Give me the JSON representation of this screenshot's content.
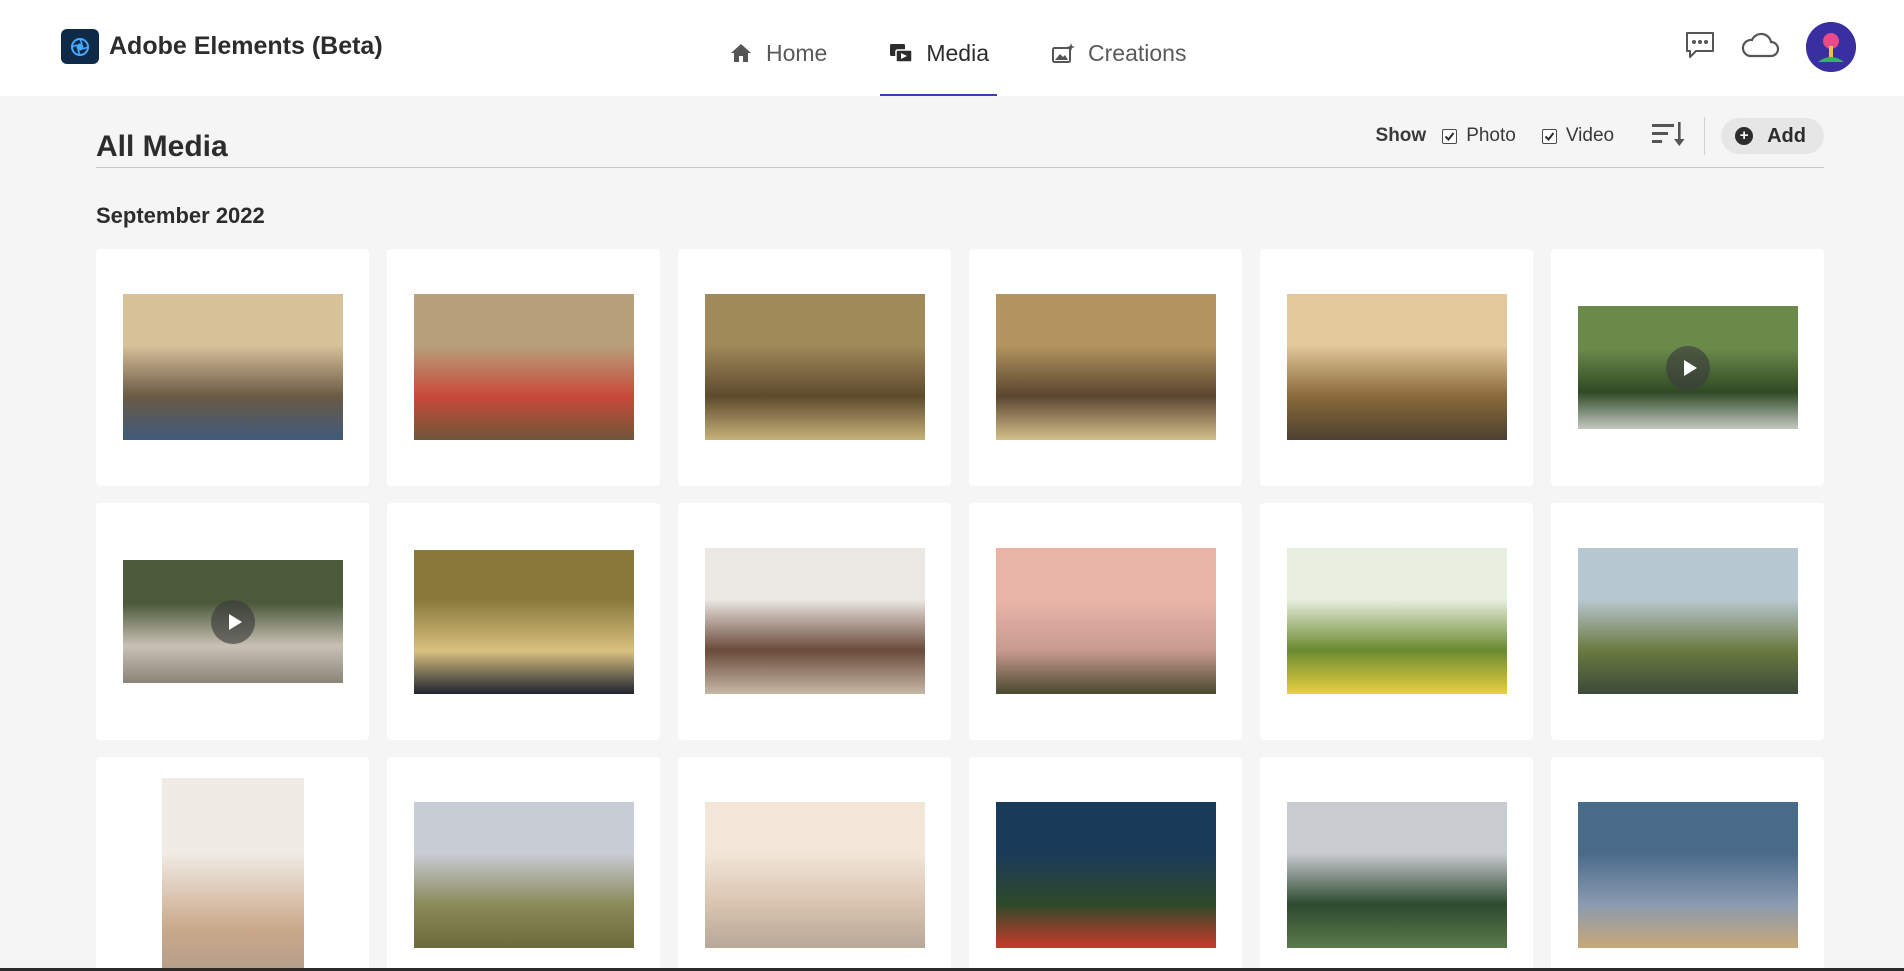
{
  "app": {
    "title": "Adobe Elements (Beta)",
    "logo_icon": "elements-logo-icon"
  },
  "nav": {
    "items": [
      {
        "label": "Home",
        "icon": "home-icon",
        "active": false
      },
      {
        "label": "Media",
        "icon": "media-icon",
        "active": true
      },
      {
        "label": "Creations",
        "icon": "creations-icon",
        "active": false
      }
    ]
  },
  "top_actions": {
    "feedback_icon": "feedback-icon",
    "cloud_icon": "cloud-icon",
    "avatar_icon": "avatar"
  },
  "page": {
    "title": "All Media",
    "show_label": "Show",
    "filters": [
      {
        "label": "Photo",
        "checked": true
      },
      {
        "label": "Video",
        "checked": true
      }
    ],
    "sort_icon": "sort-icon",
    "add_label": "Add"
  },
  "section": {
    "title": "September 2022"
  },
  "media": [
    {
      "kind": "photo",
      "colors": [
        "#d8c29a",
        "#6b5a45",
        "#3f5a7a"
      ]
    },
    {
      "kind": "photo",
      "colors": [
        "#b7a07a",
        "#c84a3a",
        "#6f5638"
      ]
    },
    {
      "kind": "photo",
      "colors": [
        "#a08a5a",
        "#5d4a2c",
        "#c7b27a"
      ]
    },
    {
      "kind": "photo",
      "colors": [
        "#b49560",
        "#5a4630",
        "#d4c08a"
      ]
    },
    {
      "kind": "photo",
      "colors": [
        "#e3c89b",
        "#8a6a3a",
        "#4d4030"
      ]
    },
    {
      "kind": "video",
      "colors": [
        "#6a8a4a",
        "#2f4a25",
        "#c4c8c0"
      ]
    },
    {
      "kind": "video",
      "colors": [
        "#4a5a3a",
        "#c9c1b5",
        "#8a8478"
      ]
    },
    {
      "kind": "photo",
      "colors": [
        "#8a7a3a",
        "#d8c080",
        "#1f2430"
      ]
    },
    {
      "kind": "photo",
      "colors": [
        "#ece8e4",
        "#6a4a3a",
        "#c8b8a8"
      ]
    },
    {
      "kind": "photo",
      "colors": [
        "#e9b5a8",
        "#c89a90",
        "#4a4a30"
      ]
    },
    {
      "kind": "photo",
      "colors": [
        "#e9efe0",
        "#6a8a30",
        "#e8d040"
      ]
    },
    {
      "kind": "photo",
      "colors": [
        "#b8c8d0",
        "#6a7a40",
        "#3a4a3a"
      ]
    },
    {
      "kind": "photo",
      "colors": [
        "#f0ebe4",
        "#caa88a",
        "#a89a8a"
      ]
    },
    {
      "kind": "photo",
      "colors": [
        "#c8ccd4",
        "#8a8a5a",
        "#6a6a3a"
      ]
    },
    {
      "kind": "photo",
      "colors": [
        "#f2e6d8",
        "#d8c4b0",
        "#b8a898"
      ]
    },
    {
      "kind": "photo",
      "colors": [
        "#1a3a5a",
        "#2e4a2a",
        "#c83a2a"
      ]
    },
    {
      "kind": "photo",
      "colors": [
        "#c8ccd0",
        "#2e4a30",
        "#5a7a4a"
      ]
    },
    {
      "kind": "photo",
      "colors": [
        "#4a6a8a",
        "#8a9ab0",
        "#c8a878"
      ]
    }
  ],
  "accent_color": "#3b3db3"
}
